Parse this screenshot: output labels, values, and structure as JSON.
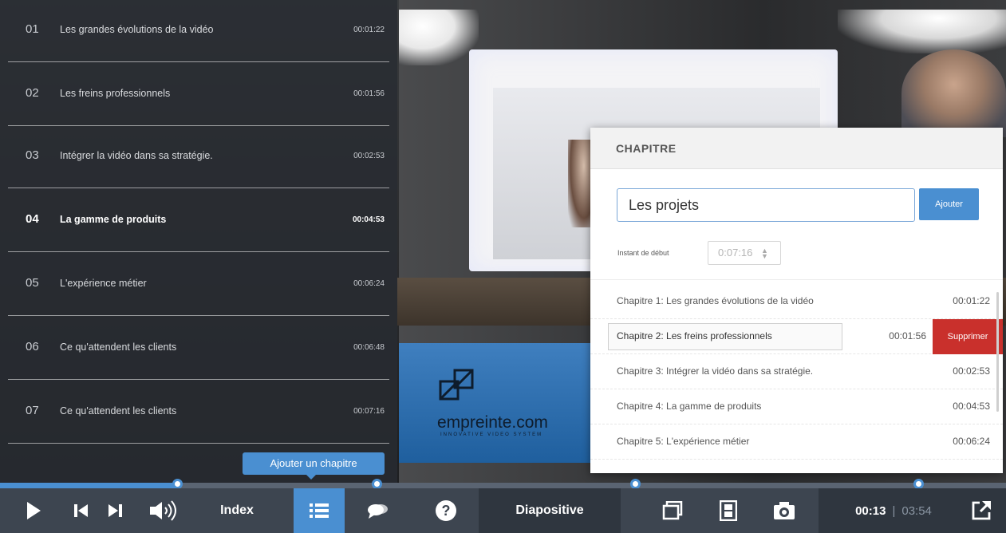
{
  "chapter_list": [
    {
      "num": "01",
      "title": "Les grandes évolutions de la vidéo",
      "time": "00:01:22",
      "active": false
    },
    {
      "num": "02",
      "title": "Les freins professionnels",
      "time": "00:01:56",
      "active": false
    },
    {
      "num": "03",
      "title": "Intégrer la vidéo dans sa stratégie.",
      "time": "00:02:53",
      "active": false
    },
    {
      "num": "04",
      "title": "La gamme de produits",
      "time": "00:04:53",
      "active": true
    },
    {
      "num": "05",
      "title": "L'expérience métier",
      "time": "00:06:24",
      "active": false
    },
    {
      "num": "06",
      "title": "Ce qu'attendent les clients",
      "time": "00:06:48",
      "active": false
    },
    {
      "num": "07",
      "title": "Ce qu'attendent les clients",
      "time": "00:07:16",
      "active": false
    }
  ],
  "add_chapter_label": "Ajouter un chapitre",
  "background_brand": {
    "name": "empreinte.com",
    "tagline": "INNOVATIVE VIDEO SYSTEM"
  },
  "panel": {
    "title": "CHAPITRE",
    "name_value": "Les projets",
    "add_label": "Ajouter",
    "start_label": "Instant de début",
    "start_value": "0:07:16",
    "chapters": [
      {
        "label": "Chapitre 1: Les grandes évolutions de la vidéo",
        "time": "00:01:22"
      },
      {
        "label": "Chapitre 2: Les freins professionnels",
        "time": "00:01:56",
        "editing": true
      },
      {
        "label": "Chapitre 3: Intégrer la vidéo dans sa stratégie.",
        "time": "00:02:53"
      },
      {
        "label": "Chapitre 4: La gamme de produits",
        "time": "00:04:53"
      },
      {
        "label": "Chapitre 5: L'expérience métier",
        "time": "00:06:24"
      }
    ],
    "delete_label": "Supprimer"
  },
  "progress": {
    "played_fraction": 0.175,
    "markers": [
      "00:01:22",
      "00:01:56",
      "00:02:53",
      "00:04:53"
    ]
  },
  "controls": {
    "index_label": "Index",
    "slides_label": "Diapositive",
    "current_time": "00:13",
    "separator": "|",
    "total_time": "03:54",
    "icons": [
      "play-icon",
      "previous-icon",
      "next-icon",
      "volume-icon",
      "chapter-list-icon",
      "comments-icon",
      "help-icon",
      "layout-icon",
      "film-icon",
      "camera-icon",
      "external-link-icon"
    ],
    "accent_color": "#4a8fd1",
    "delete_color": "#c9302c"
  }
}
